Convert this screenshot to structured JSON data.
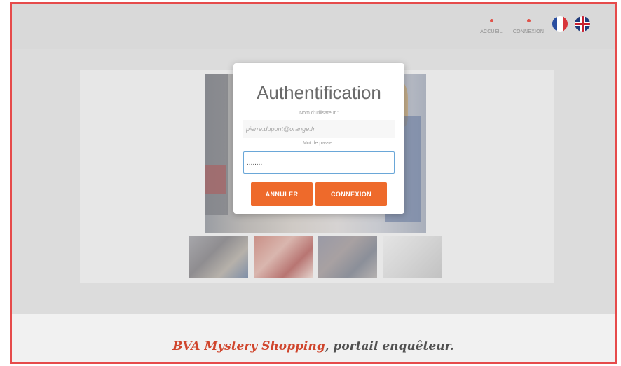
{
  "nav": {
    "home_label": "ACCUEIL",
    "login_label": "CONNEXION"
  },
  "flags": [
    {
      "name": "french-flag-icon"
    },
    {
      "name": "uk-flag-icon"
    }
  ],
  "modal": {
    "title": "Authentification",
    "username_label": "Nom d'utilisateur :",
    "username_value": "pierre.dupont@orange.fr",
    "password_label": "Mot de passe :",
    "password_value": "........",
    "cancel_label": "ANNULER",
    "login_label": "CONNEXION"
  },
  "footer": {
    "brand": "BVA Mystery Shopping",
    "suffix": ", portail enquêteur."
  },
  "colors": {
    "accent": "#ee6a2b",
    "frame_border": "#e64b4b",
    "focus_border": "#6aa7d8"
  }
}
